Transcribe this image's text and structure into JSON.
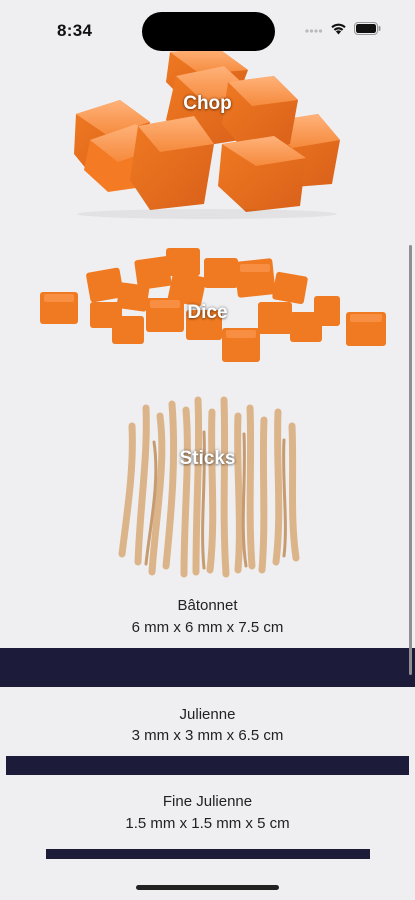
{
  "status_bar": {
    "time": "8:34"
  },
  "tiles": [
    {
      "label": "Chop"
    },
    {
      "label": "Dice"
    },
    {
      "label": "Sticks"
    }
  ],
  "cuts": [
    {
      "name": "Bâtonnet",
      "size": "6 mm x 6 mm x 7.5 cm"
    },
    {
      "name": "Julienne",
      "size": "3 mm x 3 mm x 6.5 cm"
    },
    {
      "name": "Fine Julienne",
      "size": "1.5 mm x 1.5 mm x 5 cm"
    }
  ],
  "colors": {
    "background": "#efeff1",
    "bar": "#1c1b3a",
    "squash": "#f07a22",
    "stick": "#dbb48c"
  },
  "icons": [
    "signal-icon",
    "wifi-icon",
    "battery-icon"
  ]
}
